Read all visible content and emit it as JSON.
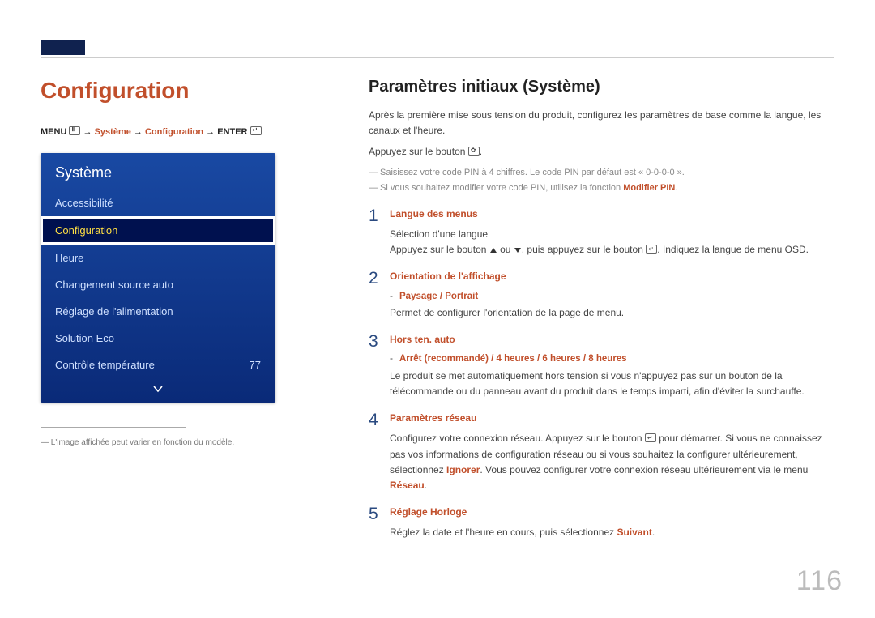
{
  "page_number": "116",
  "left": {
    "heading": "Configuration",
    "breadcrumb": {
      "prefix": "MENU",
      "arrow": " → ",
      "p1": "Système",
      "p2": "Configuration",
      "suffix": "ENTER"
    },
    "menu": {
      "title": "Système",
      "items": [
        {
          "label": "Accessibilité",
          "value": ""
        },
        {
          "label": "Configuration",
          "value": "",
          "selected": true
        },
        {
          "label": "Heure",
          "value": ""
        },
        {
          "label": "Changement source auto",
          "value": ""
        },
        {
          "label": "Réglage de l'alimentation",
          "value": ""
        },
        {
          "label": "Solution Eco",
          "value": ""
        },
        {
          "label": "Contrôle température",
          "value": "77"
        }
      ]
    },
    "footnote": "L'image affichée peut varier en fonction du modèle."
  },
  "right": {
    "heading": "Paramètres initiaux (Système)",
    "intro": "Après la première mise sous tension du produit, configurez les paramètres de base comme la langue, les canaux et l'heure.",
    "intro2_a": "Appuyez sur le bouton ",
    "intro2_b": ".",
    "note1": "Saisissez votre code PIN à 4 chiffres. Le code PIN par défaut est « 0-0-0-0 ».",
    "note2_a": "Si vous souhaitez modifier votre code PIN, utilisez la fonction ",
    "note2_b": "Modifier PIN",
    "note2_c": ".",
    "steps": [
      {
        "num": "1",
        "title": "Langue des menus",
        "l1": "Sélection d'une langue",
        "l2a": "Appuyez sur le bouton ",
        "l2b": " ou ",
        "l2c": ", puis appuyez sur le bouton ",
        "l2d": ". Indiquez la langue de menu OSD."
      },
      {
        "num": "2",
        "title": "Orientation de l'affichage",
        "sub": "Paysage / Portrait",
        "l1": "Permet de configurer l'orientation de la page de menu."
      },
      {
        "num": "3",
        "title": "Hors ten. auto",
        "sub": "Arrêt (recommandé) / 4 heures / 6 heures / 8 heures",
        "l1": "Le produit se met automatiquement hors tension si vous n'appuyez pas sur un bouton de la télécommande ou du panneau avant du produit dans le temps imparti, afin d'éviter la surchauffe."
      },
      {
        "num": "4",
        "title": "Paramètres réseau",
        "l1a": "Configurez votre connexion réseau. Appuyez sur le bouton ",
        "l1b": " pour démarrer. Si vous ne connaissez pas vos informations de configuration réseau ou si vous souhaitez la configurer ultérieurement, sélectionnez ",
        "l1c": "Ignorer",
        "l1d": ". Vous pouvez configurer votre connexion réseau ultérieurement via le menu ",
        "l1e": "Réseau",
        "l1f": "."
      },
      {
        "num": "5",
        "title": "Réglage Horloge",
        "l1a": "Réglez la date et l'heure en cours, puis sélectionnez ",
        "l1b": "Suivant",
        "l1c": "."
      }
    ]
  }
}
